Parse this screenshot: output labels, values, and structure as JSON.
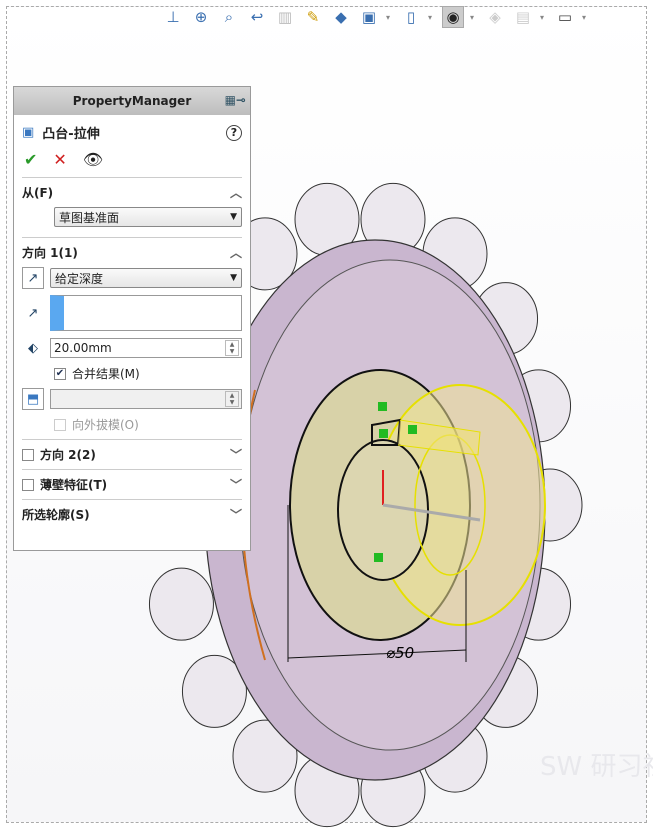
{
  "toolbar": {
    "items": [
      "view-normal-to-icon",
      "zoom-to-fit-icon",
      "zoom-to-area-icon",
      "previous-view-icon",
      "section-view-icon",
      "dynamic-annotation-icon",
      "view-orientation-icon",
      "display-style-icon",
      "hide-show-icon",
      "edit-appearance-icon",
      "apply-scene-icon",
      "view-settings-icon"
    ]
  },
  "pm": {
    "title": "PropertyManager",
    "feature_name": "凸台-拉伸",
    "from": {
      "label": "从(F)",
      "value": "草图基准面"
    },
    "dir1": {
      "label": "方向 1(1)",
      "end_condition": "给定深度",
      "depth": "20.00mm",
      "merge_label": "合并结果(M)",
      "merge_checked": true,
      "draft_value": "",
      "draft_out_label": "向外拔模(O)"
    },
    "dir2": {
      "label": "方向 2(2)"
    },
    "thin": {
      "label": "薄壁特征(T)"
    },
    "contours": {
      "label": "所选轮廓(S)"
    }
  },
  "model": {
    "dimension": "⌀50"
  },
  "watermark": {
    "text": "SW 研习社"
  },
  "colors": {
    "gear": "#cdb9d3",
    "boss": "#e8df9c",
    "sketch": "#f5f000",
    "ok": "#2a9a2a",
    "cancel": "#d02020"
  }
}
